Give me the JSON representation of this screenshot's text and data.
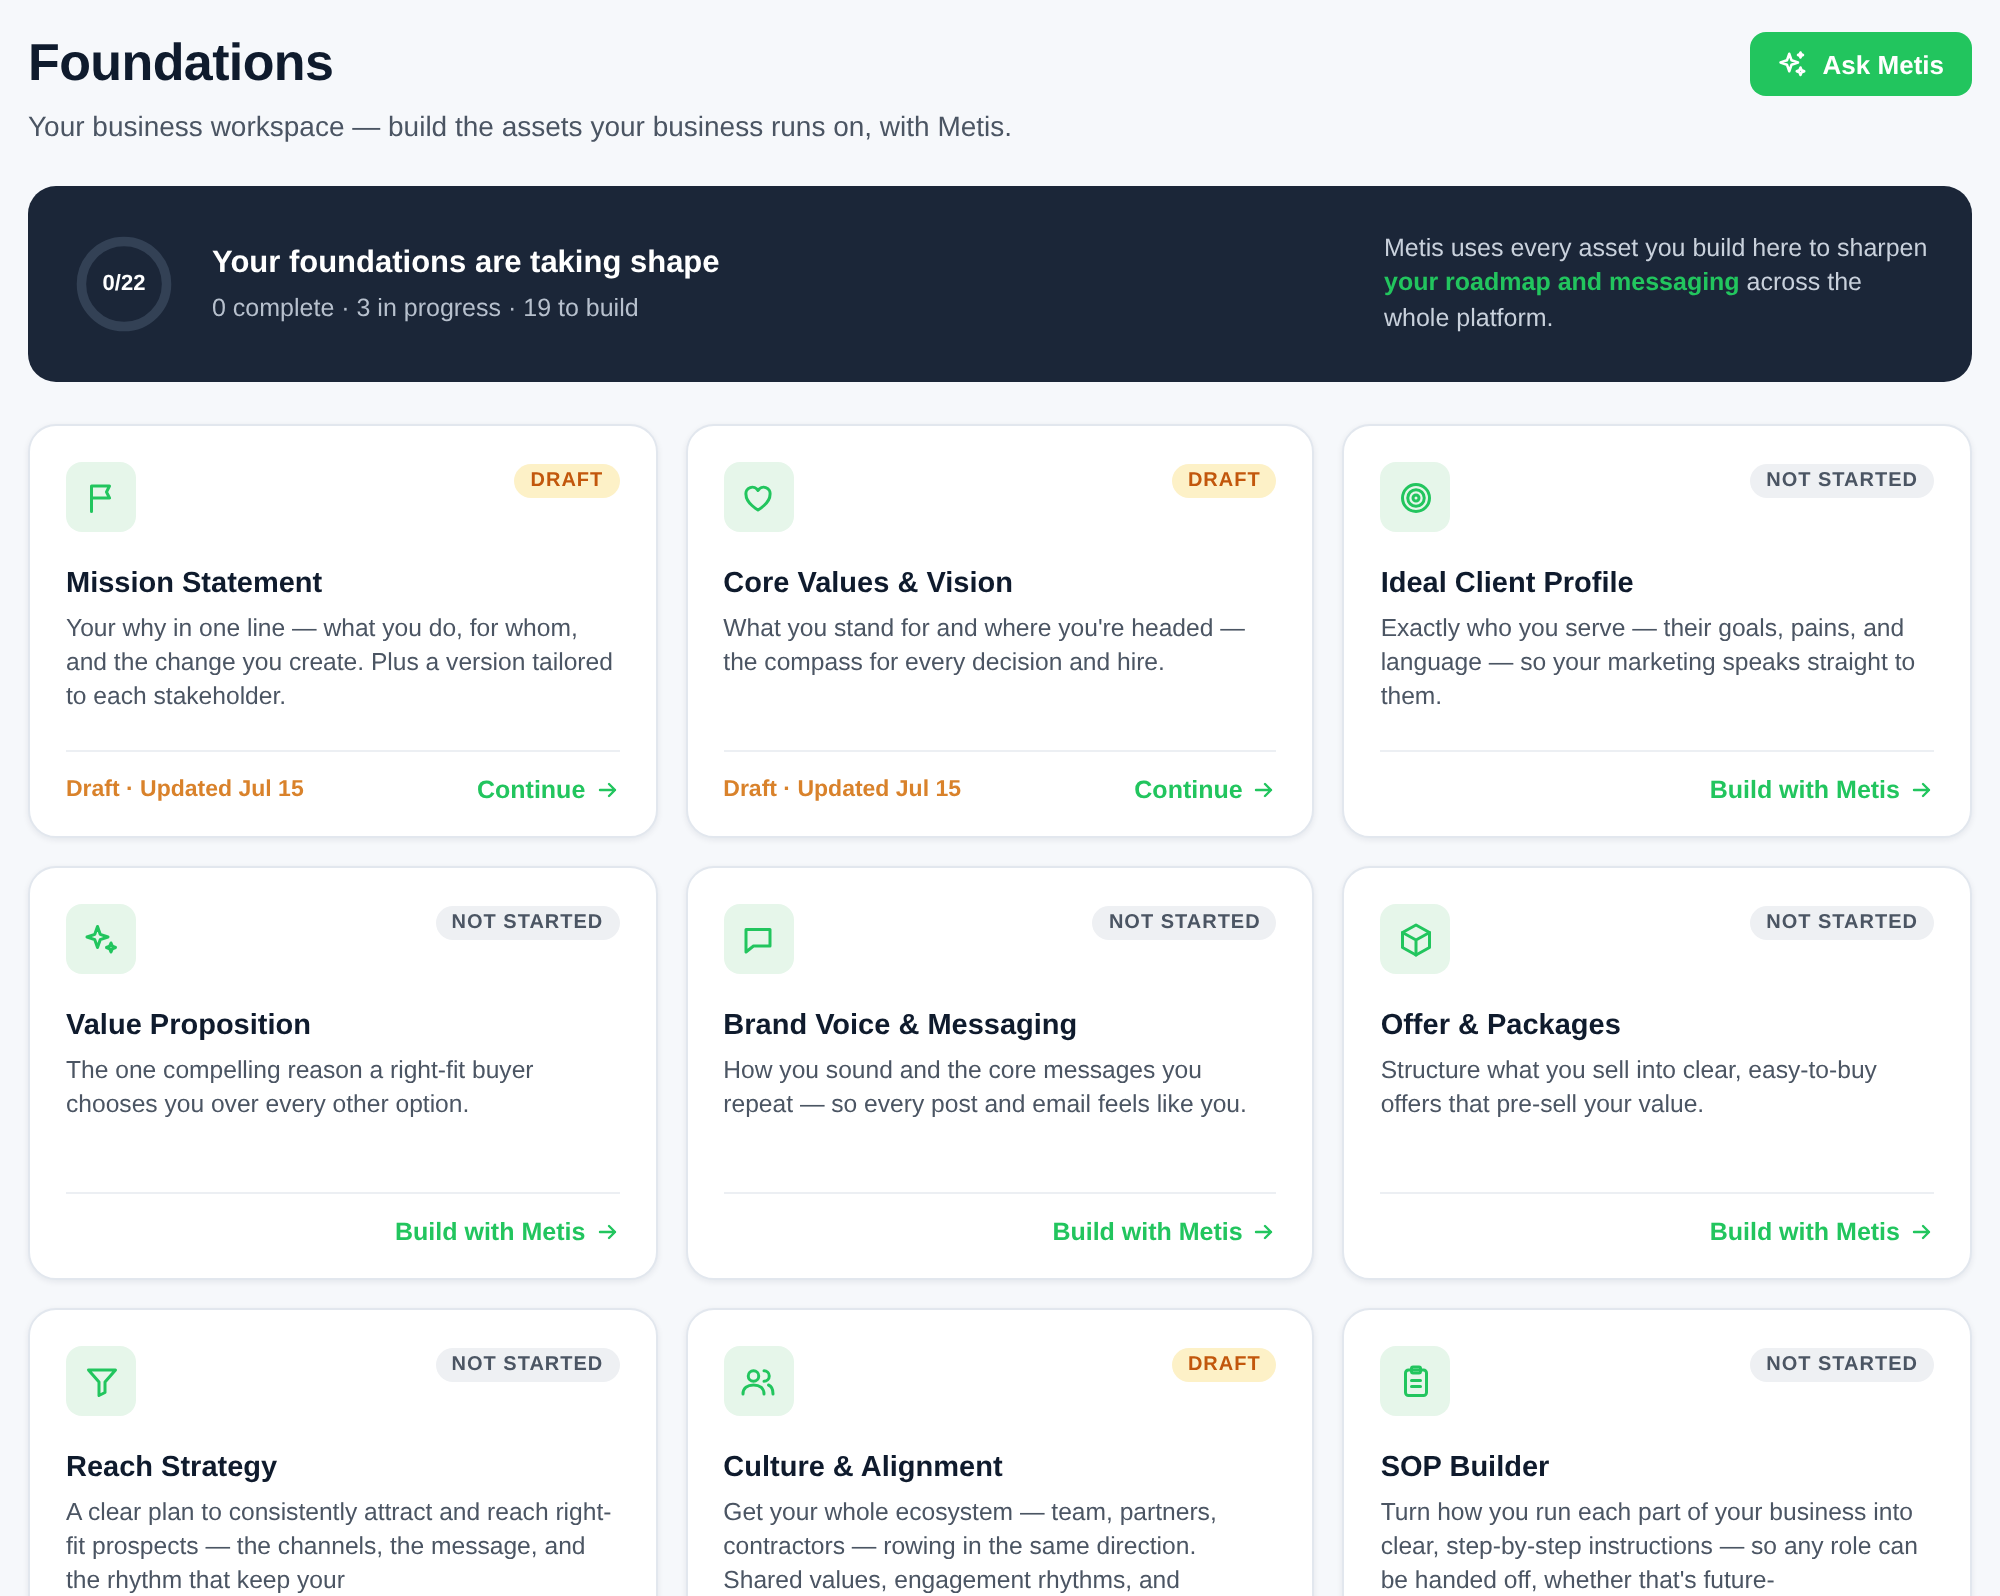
{
  "header": {
    "title": "Foundations",
    "subtitle": "Your business workspace — build the assets your business runs on, with Metis.",
    "button": "Ask Metis"
  },
  "banner": {
    "progress_label": "0/22",
    "level": 0,
    "title": "Your foundations are taking shape",
    "stats": "0 complete · 3 in progress · 19 to build",
    "note": "Metis uses every asset you build here to sharpen **your roadmap and messaging** across the whole platform."
  },
  "cards": [
    {
      "kind": "draft",
      "badge": "DRAFT",
      "title": "Mission Statement",
      "description": "Your why in one line — what you do, for whom, and the change you create. Plus a version tailored to each stakeholder.",
      "meta": "Draft · Updated Jul 15",
      "action": "Continue"
    },
    {
      "kind": "draft",
      "badge": "DRAFT",
      "title": "Core Values & Vision",
      "description": "What you stand for and where you're headed — the compass for every decision and hire.",
      "meta": "Draft · Updated Jul 15",
      "action": "Continue"
    },
    {
      "kind": "not_started",
      "badge": "NOT STARTED",
      "title": "Ideal Client Profile",
      "description": "Exactly who you serve — their goals, pains, and language — so your marketing speaks straight to them.",
      "action": "Build with Metis"
    },
    {
      "kind": "not_started",
      "badge": "NOT STARTED",
      "title": "Value Proposition",
      "description": "The one compelling reason a right-fit buyer chooses you over every other option.",
      "action": "Build with Metis"
    },
    {
      "kind": "not_started",
      "badge": "NOT STARTED",
      "title": "Brand Voice & Messaging",
      "description": "How you sound and the core messages you repeat — so every post and email feels like you.",
      "action": "Build with Metis"
    },
    {
      "kind": "not_started",
      "badge": "NOT STARTED",
      "title": "Offer & Packages",
      "description": "Structure what you sell into clear, easy-to-buy offers that pre-sell your value.",
      "action": "Build with Metis"
    },
    {
      "kind": "not_started",
      "badge": "NOT STARTED",
      "title": "Reach Strategy",
      "description": "A clear plan to consistently attract and reach right-fit prospects — the channels, the message, and the rhythm that keep your"
    },
    {
      "kind": "draft",
      "badge": "DRAFT",
      "title": "Culture & Alignment",
      "description": "Get your whole ecosystem — team, partners, contractors — rowing in the same direction. Shared values, engagement rhythms, and"
    },
    {
      "kind": "not_started",
      "badge": "NOT STARTED",
      "title": "SOP Builder",
      "description": "Turn how you run each part of your business into clear, step-by-step instructions — so any role can be handed off, whether that's future-"
    }
  ]
}
